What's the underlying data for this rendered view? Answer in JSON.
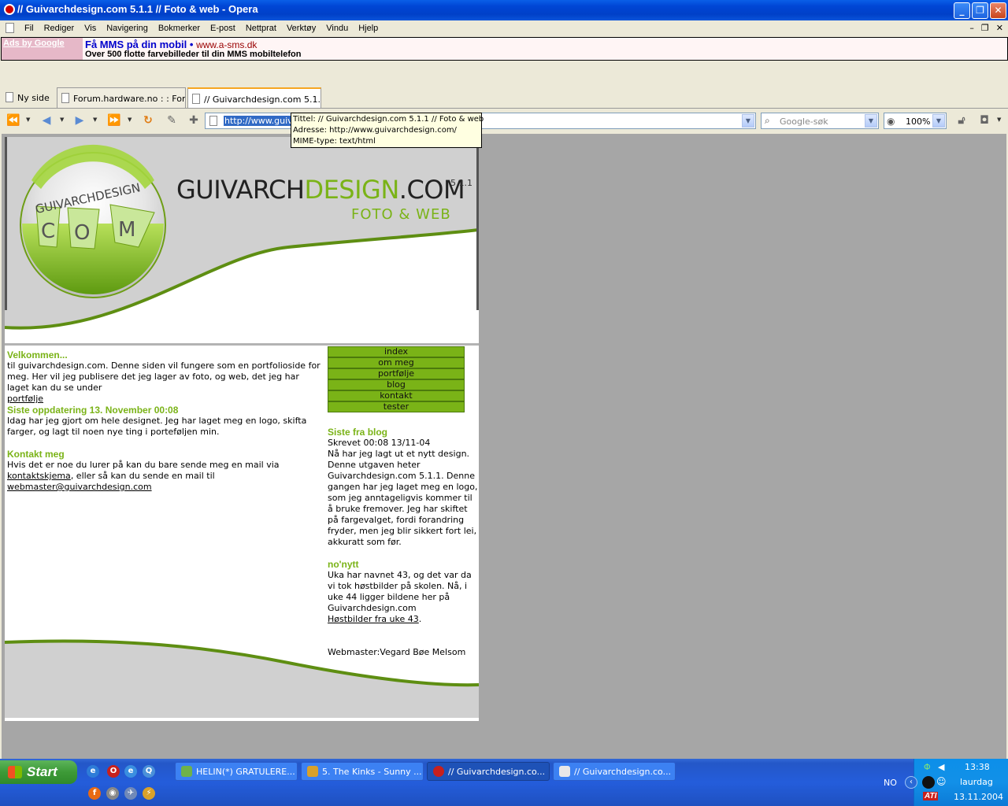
{
  "window": {
    "title": "// Guivarchdesign.com 5.1.1 // Foto & web - Opera"
  },
  "menubar": {
    "items": [
      "Fil",
      "Rediger",
      "Vis",
      "Navigering",
      "Bokmerker",
      "E-post",
      "Nettprat",
      "Verktøy",
      "Vindu",
      "Hjelp"
    ]
  },
  "ad": {
    "ads_by": "Ads by Google",
    "headline": "Få MMS på din mobil",
    "bullet": " • ",
    "url": "www.a-sms.dk",
    "text": "Over 500 flotte farvebilleder til din MMS mobiltelefon"
  },
  "tabs": {
    "new_page": "Ny side",
    "tab1": "Forum.hardware.no : : For...",
    "tab2": "// Guivarchdesign.com 5.1..."
  },
  "address": {
    "url": "http://www.guivarchdesign.com/",
    "search_placeholder": "Google-søk",
    "zoom": "100%"
  },
  "tooltip": {
    "line1": "Tittel: // Guivarchdesign.com 5.1.1 // Foto & web",
    "line2": "Adresse: http://www.guivarchdesign.com/",
    "line3": "MIME-type: text/html"
  },
  "site": {
    "logo_text": "GUIVARCHDESIGN",
    "logo_c": "C",
    "logo_o": "O",
    "logo_m": "M",
    "title_a": "GUIVARCH",
    "title_b": "DESIGN",
    "title_c": ".COM",
    "version": "5.1.1",
    "subtitle": "FOTO & WEB",
    "welcome_h": "Velkommen...",
    "welcome_t": "til guivarchdesign.com. Denne siden vil fungere som en portfolioside for meg. Her vil jeg publisere det jeg lager av foto, og web, det jeg har laget kan du se under",
    "welcome_link": "portfølje",
    "update_h": "Siste oppdatering 13. November 00:08",
    "update_t": "Idag har jeg gjort om hele designet. Jeg har laget meg en logo, skifta farger, og lagt til noen nye ting i porteføljen min.",
    "contact_h": "Kontakt meg",
    "contact_t1": "Hvis det er noe du lurer på kan du bare sende meg en mail via",
    "contact_link1": "kontaktskjema",
    "contact_t2": ", eller så kan du sende en mail til",
    "contact_link2": "webmaster@guivarchdesign.com",
    "menu": [
      "index",
      "om meg",
      "portfølje",
      "blog",
      "kontakt",
      "tester"
    ],
    "blog_h": "Siste fra blog",
    "blog_date": "Skrevet 00:08 13/11-04",
    "blog_t": "Nå har jeg lagt ut et nytt design. Denne utgaven heter Guivarchdesign.com 5.1.1. Denne gangen har jeg laget meg en logo, som jeg anntageligvis kommer til å bruke fremover. Jeg har skiftet på fargevalget, fordi forandring fryder, men jeg blir sikkert fort lei, akkuratt som før.",
    "nonytt_h": "no'nytt",
    "nonytt_t": "Uka har navnet 43, og det var da vi tok høstbilder på skolen. Nå, i uke 44 ligger bildene her på Guivarchdesign.com",
    "nonytt_link": "Høstbilder fra uke 43",
    "webmaster": "Webmaster:Vegard Bøe Melsom"
  },
  "taskbar": {
    "start": "Start",
    "tasks": [
      "HELIN(*) GRATULERE...",
      "5. The Kinks - Sunny ...",
      "// Guivarchdesign.co...",
      "// Guivarchdesign.co..."
    ],
    "lang": "NO",
    "time": "13:38",
    "day": "laurdag",
    "date": "13.11.2004",
    "ati": "ATI"
  },
  "colors": {
    "accent_green": "#7AB317",
    "xp_blue": "#245DDB"
  }
}
